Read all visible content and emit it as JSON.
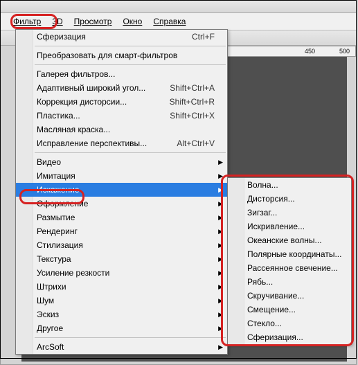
{
  "menubar": {
    "filter": "Фильтр",
    "threeD": "3D",
    "view": "Просмотр",
    "window": "Окно",
    "help": "Справка"
  },
  "ruler": {
    "t450": "450",
    "t500": "500"
  },
  "menu": {
    "last": "Сферизация",
    "last_shortcut": "Ctrl+F",
    "convert_smart": "Преобразовать для смарт-фильтров",
    "gallery": "Галерея фильтров...",
    "adaptive": "Адаптивный широкий угол...",
    "adaptive_sc": "Shift+Ctrl+A",
    "lens": "Коррекция дисторсии...",
    "lens_sc": "Shift+Ctrl+R",
    "liquify": "Пластика...",
    "liquify_sc": "Shift+Ctrl+X",
    "oil": "Масляная краска...",
    "vanish": "Исправление перспективы...",
    "vanish_sc": "Alt+Ctrl+V",
    "video": "Видео",
    "imitation": "Имитация",
    "distort": "Искажение",
    "decor": "Оформление",
    "blur": "Размытие",
    "render": "Рендеринг",
    "stylize": "Стилизация",
    "texture": "Текстура",
    "sharpen": "Усиление резкости",
    "strokes": "Штрихи",
    "noise": "Шум",
    "sketch": "Эскиз",
    "other": "Другое",
    "arcsoft": "ArcSoft"
  },
  "submenu": {
    "wave": "Волна...",
    "distortion": "Дисторсия...",
    "zigzag": "Зигзаг...",
    "curve": "Искривление...",
    "ocean": "Океанские волны...",
    "polar": "Полярные координаты...",
    "diffuse": "Рассеянное свечение...",
    "ripple": "Рябь...",
    "twirl": "Скручивание...",
    "shift": "Смещение...",
    "glass": "Стекло...",
    "spherize": "Сферизация..."
  }
}
